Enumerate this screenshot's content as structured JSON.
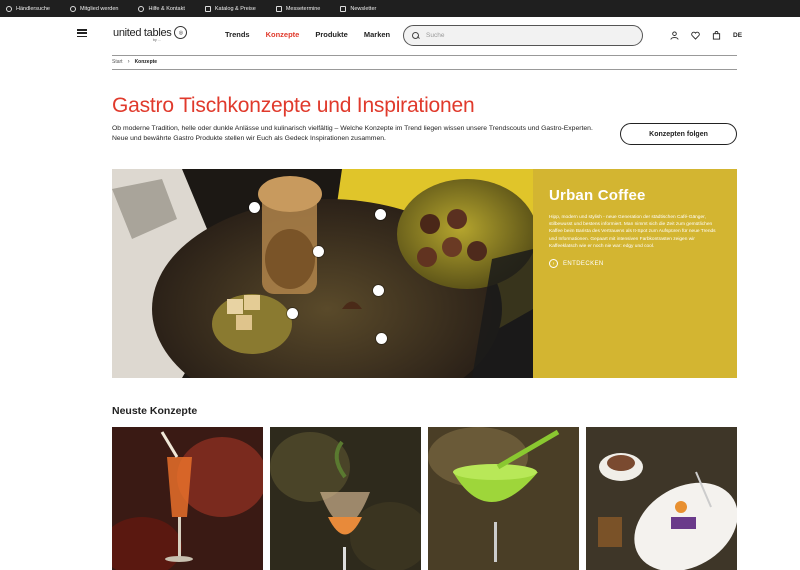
{
  "topbar": {
    "items": [
      {
        "label": "Händlersuche",
        "icon": "location-pin-icon"
      },
      {
        "label": "Mitglied werden",
        "icon": "user-icon"
      },
      {
        "label": "Hilfe & Kontakt",
        "icon": "phone-icon"
      },
      {
        "label": "Katalog & Preise",
        "icon": "catalog-icon"
      },
      {
        "label": "Messetermine",
        "icon": "calendar-icon"
      },
      {
        "label": "Newsletter",
        "icon": "mail-icon"
      }
    ]
  },
  "header": {
    "logo_text": "united tables",
    "logo_sub": "by ...",
    "nav": [
      {
        "label": "Trends",
        "active": false
      },
      {
        "label": "Konzepte",
        "active": true
      },
      {
        "label": "Produkte",
        "active": false
      },
      {
        "label": "Marken",
        "active": false
      }
    ],
    "search_placeholder": "Suche",
    "language": "DE"
  },
  "breadcrumb": {
    "home": "Start",
    "current": "Konzepte"
  },
  "main": {
    "title": "Gastro Tischkonzepte und Inspirationen",
    "intro": "Ob moderne Tradition, helle oder dunkle Anlässe und kulinarisch vielfältig – Welche Konzepte im Trend liegen wissen unsere Trendscouts und Gastro-Experten. Neue und bewährte Gastro Produkte stellen wir Euch als Gedeck Inspirationen zusammen.",
    "follow_label": "Konzepten folgen"
  },
  "hero": {
    "title": "Urban Coffee",
    "text": "Hipp, modern und stylish - neue Generation der städtischen Café-Gänger, stilbewusst und bestens informiert. Man nimmt sich die Zeit zum gemütlichen Kaffee beim Barista des Vertrauens als It-Spot zum Aufspüren für neue Trends und Informationen. Gepaart mit intensiven Farbkontrasten zeigen wir Kaffeeklatsch wie er noch nie war: edgy und cool.",
    "cta": "ENTDECKEN",
    "panel_color": "#d3b531"
  },
  "section": {
    "title": "Neuste Konzepte"
  },
  "colors": {
    "accent": "#e03a2c",
    "topbar": "#1f1f1f"
  }
}
